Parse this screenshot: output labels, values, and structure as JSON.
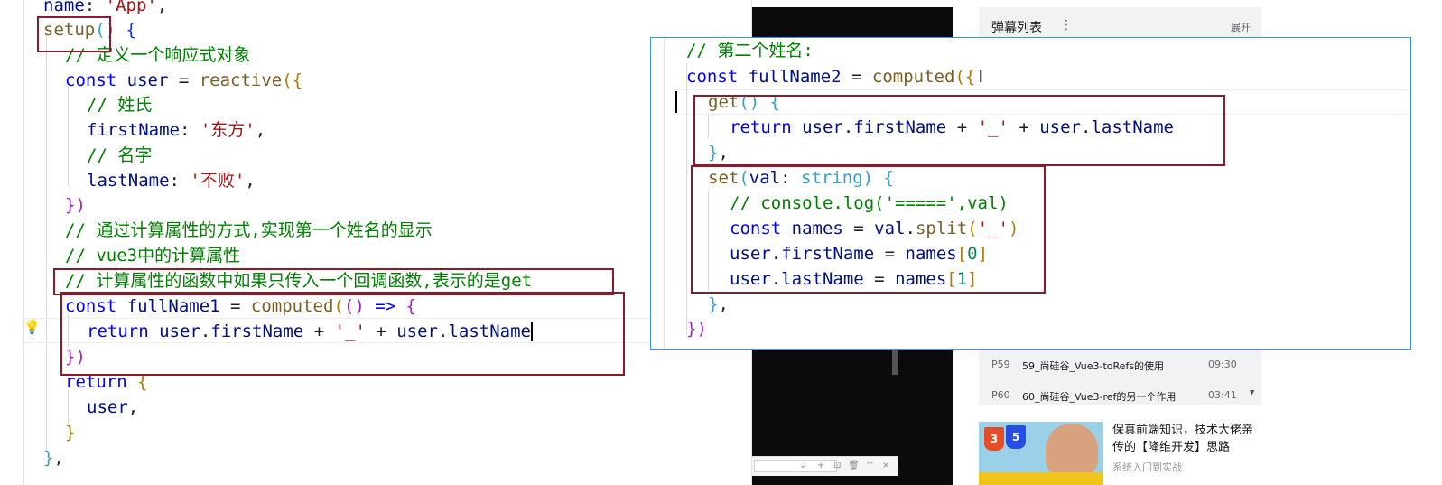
{
  "left_editor": {
    "lines": [
      [
        {
          "t": "name",
          "c": "id"
        },
        {
          "t": ": ",
          "c": "pl"
        },
        {
          "t": "'App'",
          "c": "str"
        },
        {
          "t": ",",
          "c": "pl"
        }
      ],
      [
        {
          "t": "setup",
          "c": "fn"
        },
        {
          "t": "() ",
          "c": "br4"
        },
        {
          "t": "{",
          "c": "br1"
        }
      ],
      [
        {
          "t": "// 定义一个响应式对象",
          "c": "cmt"
        }
      ],
      [
        {
          "t": "const ",
          "c": "kw"
        },
        {
          "t": "user",
          "c": "id"
        },
        {
          "t": " = ",
          "c": "pl"
        },
        {
          "t": "reactive",
          "c": "fn"
        },
        {
          "t": "({",
          "c": "br2"
        }
      ],
      [
        {
          "t": "// 姓氏",
          "c": "cmt"
        }
      ],
      [
        {
          "t": "firstName",
          "c": "id"
        },
        {
          "t": ": ",
          "c": "pl"
        },
        {
          "t": "'东方'",
          "c": "str"
        },
        {
          "t": ",",
          "c": "pl"
        }
      ],
      [
        {
          "t": "// 名字",
          "c": "cmt"
        }
      ],
      [
        {
          "t": "lastName",
          "c": "id"
        },
        {
          "t": ": ",
          "c": "pl"
        },
        {
          "t": "'不败'",
          "c": "str"
        },
        {
          "t": ",",
          "c": "pl"
        }
      ],
      [
        {
          "t": "})",
          "c": "br3"
        }
      ],
      [
        {
          "t": "// 通过计算属性的方式,实现第一个姓名的显示",
          "c": "cmt"
        }
      ],
      [
        {
          "t": "// vue3中的计算属性",
          "c": "cmt"
        }
      ],
      [
        {
          "t": "// 计算属性的函数中如果只传入一个回调函数,表示的是get",
          "c": "cmt"
        }
      ],
      [
        {
          "t": "const ",
          "c": "kw"
        },
        {
          "t": "fullName1",
          "c": "id"
        },
        {
          "t": " = ",
          "c": "pl"
        },
        {
          "t": "computed",
          "c": "fn"
        },
        {
          "t": "(",
          "c": "br2"
        },
        {
          "t": "() ",
          "c": "br3"
        },
        {
          "t": "=> ",
          "c": "kw"
        },
        {
          "t": "{",
          "c": "br3"
        }
      ],
      [
        {
          "t": "return ",
          "c": "kw"
        },
        {
          "t": "user",
          "c": "id"
        },
        {
          "t": ".",
          "c": "pl"
        },
        {
          "t": "firstName",
          "c": "id"
        },
        {
          "t": " + ",
          "c": "pl"
        },
        {
          "t": "'_'",
          "c": "str"
        },
        {
          "t": " + ",
          "c": "pl"
        },
        {
          "t": "user",
          "c": "id"
        },
        {
          "t": ".",
          "c": "pl"
        },
        {
          "t": "lastName",
          "c": "id"
        }
      ],
      [
        {
          "t": "})",
          "c": "br3"
        }
      ],
      [
        {
          "t": "return ",
          "c": "kw"
        },
        {
          "t": "{",
          "c": "br2"
        }
      ],
      [
        {
          "t": "user",
          "c": "id"
        },
        {
          "t": ",",
          "c": "pl"
        }
      ],
      [
        {
          "t": "}",
          "c": "br2"
        }
      ],
      [
        {
          "t": "}",
          "c": "br4"
        },
        {
          "t": ",",
          "c": "pl"
        }
      ]
    ]
  },
  "popup_editor": {
    "lines": [
      [
        {
          "t": "// 第二个姓名:",
          "c": "cmt"
        }
      ],
      [
        {
          "t": "const ",
          "c": "kw"
        },
        {
          "t": "fullName2",
          "c": "id"
        },
        {
          "t": " = ",
          "c": "pl"
        },
        {
          "t": "computed",
          "c": "fn"
        },
        {
          "t": "({",
          "c": "br2"
        }
      ],
      [
        {
          "t": "get",
          "c": "fn"
        },
        {
          "t": "() ",
          "c": "br4"
        },
        {
          "t": "{",
          "c": "br4"
        }
      ],
      [
        {
          "t": "return ",
          "c": "kw"
        },
        {
          "t": "user",
          "c": "id"
        },
        {
          "t": ".",
          "c": "pl"
        },
        {
          "t": "firstName",
          "c": "id"
        },
        {
          "t": " + ",
          "c": "pl"
        },
        {
          "t": "'_'",
          "c": "str"
        },
        {
          "t": " + ",
          "c": "pl"
        },
        {
          "t": "user",
          "c": "id"
        },
        {
          "t": ".",
          "c": "pl"
        },
        {
          "t": "lastName",
          "c": "id"
        }
      ],
      [
        {
          "t": "}",
          "c": "br4"
        },
        {
          "t": ",",
          "c": "pl"
        }
      ],
      [
        {
          "t": "set",
          "c": "fn"
        },
        {
          "t": "(",
          "c": "br4"
        },
        {
          "t": "val",
          "c": "id"
        },
        {
          "t": ": ",
          "c": "pl"
        },
        {
          "t": "string",
          "c": "br4"
        },
        {
          "t": ") ",
          "c": "br4"
        },
        {
          "t": "{",
          "c": "br4"
        }
      ],
      [
        {
          "t": "// console.log('=====',val)",
          "c": "cmt"
        }
      ],
      [
        {
          "t": "const ",
          "c": "kw"
        },
        {
          "t": "names",
          "c": "id"
        },
        {
          "t": " = ",
          "c": "pl"
        },
        {
          "t": "val",
          "c": "id"
        },
        {
          "t": ".",
          "c": "pl"
        },
        {
          "t": "split",
          "c": "fn"
        },
        {
          "t": "(",
          "c": "br2"
        },
        {
          "t": "'_'",
          "c": "str"
        },
        {
          "t": ")",
          "c": "br2"
        }
      ],
      [
        {
          "t": "user",
          "c": "id"
        },
        {
          "t": ".",
          "c": "pl"
        },
        {
          "t": "firstName",
          "c": "id"
        },
        {
          "t": " = ",
          "c": "pl"
        },
        {
          "t": "names",
          "c": "id"
        },
        {
          "t": "[",
          "c": "br2"
        },
        {
          "t": "0",
          "c": "num"
        },
        {
          "t": "]",
          "c": "br2"
        }
      ],
      [
        {
          "t": "user",
          "c": "id"
        },
        {
          "t": ".",
          "c": "pl"
        },
        {
          "t": "lastName",
          "c": "id"
        },
        {
          "t": " = ",
          "c": "pl"
        },
        {
          "t": "names",
          "c": "id"
        },
        {
          "t": "[",
          "c": "br2"
        },
        {
          "t": "1",
          "c": "num"
        },
        {
          "t": "]",
          "c": "br2"
        }
      ],
      [
        {
          "t": "}",
          "c": "br4"
        },
        {
          "t": ",",
          "c": "pl"
        }
      ],
      [
        {
          "t": "})",
          "c": "br3"
        }
      ]
    ]
  },
  "sidebar": {
    "danmaku_title": "弹幕列表",
    "danmaku_menu_icon": "⋮",
    "expand_label": "展开",
    "episodes": [
      {
        "code": "P59",
        "title": "59_尚硅谷_Vue3-toRefs的使用",
        "duration": "09:30"
      },
      {
        "code": "P60",
        "title": "60_尚硅谷_Vue3-ref的另一个作用",
        "duration": "03:41"
      }
    ],
    "recommendation": {
      "title": "保真前端知识，技术大佬亲传的【降维开发】思路",
      "subtitle": "系统入门到实战"
    }
  },
  "bottom_toolbar": {
    "icons": [
      "+",
      "⊡",
      "🗑",
      "^",
      "×"
    ]
  },
  "colors": {
    "highlight_box": "#8b1a2b",
    "popup_border": "#3794ff",
    "keyword": "#0000ff",
    "function": "#795e26",
    "identifier": "#001080",
    "string": "#a31515",
    "comment": "#008000",
    "number": "#098658"
  }
}
